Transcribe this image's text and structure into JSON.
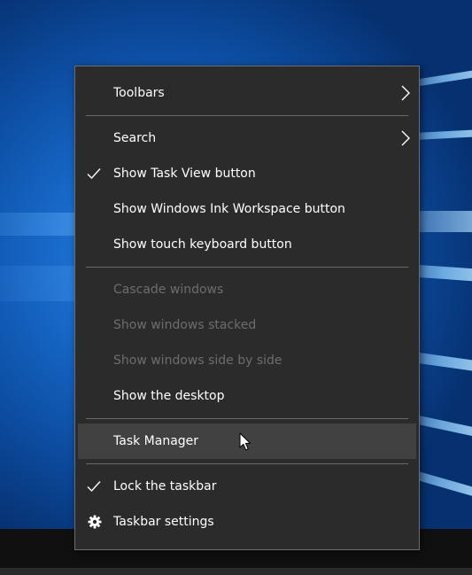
{
  "menu": {
    "items": [
      {
        "label": "Toolbars",
        "submenu": true
      },
      {
        "label": "Search",
        "submenu": true
      },
      {
        "label": "Show Task View button",
        "checked": true
      },
      {
        "label": "Show Windows Ink Workspace button"
      },
      {
        "label": "Show touch keyboard button"
      },
      {
        "label": "Cascade windows",
        "disabled": true
      },
      {
        "label": "Show windows stacked",
        "disabled": true
      },
      {
        "label": "Show windows side by side",
        "disabled": true
      },
      {
        "label": "Show the desktop"
      },
      {
        "label": "Task Manager",
        "highlighted": true
      },
      {
        "label": "Lock the taskbar",
        "checked": true
      },
      {
        "label": "Taskbar settings",
        "icon": "gear-icon"
      }
    ]
  },
  "colors": {
    "menu_background": "#2b2b2b",
    "menu_text": "#ffffff",
    "disabled_text": "#6d6d6d",
    "hover_background": "#414141",
    "separator": "#6a6a6a",
    "taskbar": "#101010"
  }
}
